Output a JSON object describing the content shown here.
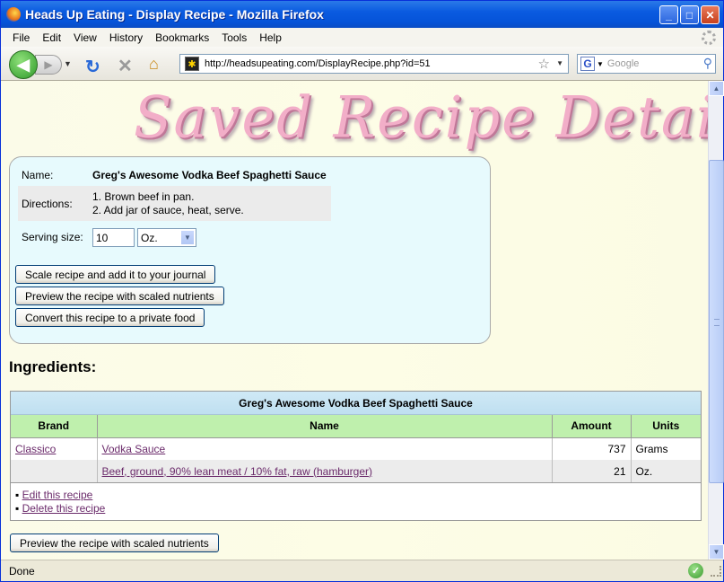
{
  "window": {
    "title": "Heads Up Eating - Display Recipe - Mozilla Firefox",
    "min_label": "_",
    "max_label": "□",
    "close_label": "✕"
  },
  "menu": [
    "File",
    "Edit",
    "View",
    "History",
    "Bookmarks",
    "Tools",
    "Help"
  ],
  "nav": {
    "url": "http://headsupeating.com/DisplayRecipe.php?id=51",
    "search_placeholder": "Google",
    "search_engine_letter": "G"
  },
  "page": {
    "heading": "Saved Recipe Details",
    "name_label": "Name:",
    "name_value": "Greg's Awesome Vodka Beef Spaghetti Sauce",
    "directions_label": "Directions:",
    "directions_line1": "1. Brown beef in pan.",
    "directions_line2": "2. Add jar of sauce, heat, serve.",
    "serving_label": "Serving size:",
    "serving_value": "10",
    "serving_unit": "Oz.",
    "btn_scale": "Scale recipe and add it to your journal",
    "btn_preview": "Preview the recipe with scaled nutrients",
    "btn_convert": "Convert this recipe to a private food",
    "ingredients_heading": "Ingredients:",
    "table_caption": "Greg's Awesome Vodka Beef Spaghetti Sauce",
    "columns": [
      "Brand",
      "Name",
      "Amount",
      "Units"
    ],
    "rows": [
      {
        "brand": "Classico",
        "name": "Vodka Sauce",
        "amount": "737",
        "units": "Grams"
      },
      {
        "brand": "",
        "name": "Beef, ground, 90% lean meat / 10% fat, raw (hamburger)",
        "amount": "21",
        "units": "Oz."
      }
    ],
    "edit_link": "Edit this recipe",
    "delete_link": "Delete this recipe",
    "btn_preview_bottom": "Preview the recipe with scaled nutrients"
  },
  "status": {
    "text": "Done"
  }
}
